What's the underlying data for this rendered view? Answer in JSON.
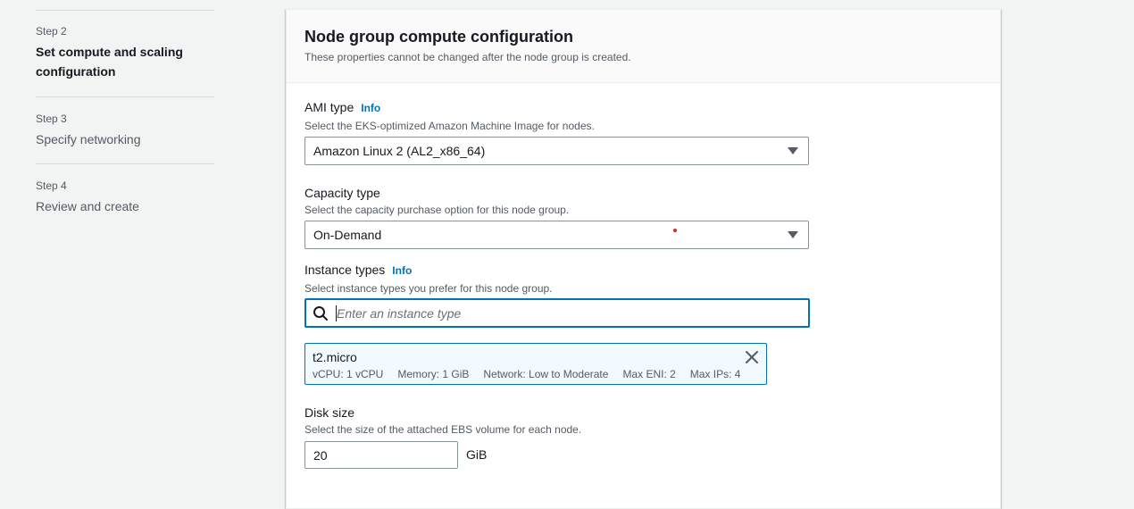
{
  "steps": [
    {
      "number": "Step 2",
      "title": "Set compute and scaling configuration",
      "active": true
    },
    {
      "number": "Step 3",
      "title": "Specify networking",
      "active": false
    },
    {
      "number": "Step 4",
      "title": "Review and create",
      "active": false
    }
  ],
  "panel": {
    "title": "Node group compute configuration",
    "description": "These properties cannot be changed after the node group is created."
  },
  "ami_type": {
    "label": "AMI type",
    "info": "Info",
    "description": "Select the EKS-optimized Amazon Machine Image for nodes.",
    "value": "Amazon Linux 2 (AL2_x86_64)"
  },
  "capacity_type": {
    "label": "Capacity type",
    "description": "Select the capacity purchase option for this node group.",
    "value": "On-Demand"
  },
  "instance_types": {
    "label": "Instance types",
    "info": "Info",
    "description": "Select instance types you prefer for this node group.",
    "placeholder": "Enter an instance type",
    "selected": {
      "name": "t2.micro",
      "vcpu": "vCPU: 1 vCPU",
      "memory": "Memory: 1 GiB",
      "network": "Network: Low to Moderate",
      "max_eni": "Max ENI: 2",
      "max_ips": "Max IPs: 4"
    }
  },
  "disk_size": {
    "label": "Disk size",
    "description": "Select the size of the attached EBS volume for each node.",
    "value": "20",
    "unit": "GiB"
  },
  "colors": {
    "accent": "#0073bb",
    "token_bg": "#f1faff",
    "marker": "#d13212"
  },
  "icons": {
    "search": "search-icon",
    "close": "close-icon",
    "caret": "caret-down-icon"
  }
}
